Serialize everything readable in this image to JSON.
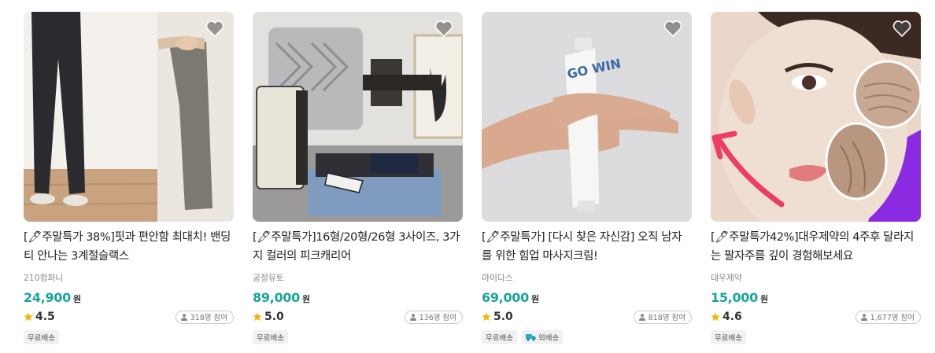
{
  "products": [
    {
      "title": "[🖊주말특가 38%]핏과 편안함 최대치! 밴딩 티 안나는 3계절슬랙스",
      "seller": "210컴퍼니",
      "price": "24,900",
      "currency": "원",
      "rating": "4.5",
      "participants": "318명 참여",
      "tags": [
        "무료배송"
      ],
      "image_icon": "slacks-photo"
    },
    {
      "title": "[🖊주말특가]16형/20형/26형 3사이즈, 3가지 컬러의 피크캐리어",
      "seller": "공정뮤토",
      "price": "89,000",
      "currency": "원",
      "rating": "5.0",
      "participants": "136명 참여",
      "tags": [
        "무료배송"
      ],
      "image_icon": "carrier-photo"
    },
    {
      "title": "[🖊주말특가] [다시 찾은 자신감] 오직 남자를 위한 힘업 마사지크림!",
      "seller": "마이다스",
      "price": "69,000",
      "currency": "원",
      "rating": "5.0",
      "participants": "818명 참여",
      "tags": [
        "무료배송",
        "외배송"
      ],
      "image_icon": "cream-tube-photo"
    },
    {
      "title": "[🖊주말특가42%]대우제약의 4주후 달라지는 팔자주름 깊이 경험해보세요",
      "seller": "대우제약",
      "price": "15,000",
      "currency": "원",
      "rating": "4.6",
      "participants": "1,677명 참여",
      "tags": [
        "무료배송"
      ],
      "image_icon": "face-wrinkle-photo"
    }
  ],
  "colors": {
    "price": "#1aa59a",
    "star": "#f5b400",
    "truck": "#2ea8c9"
  },
  "icons": {
    "wishlist": "heart-icon",
    "rating": "star-icon",
    "participants": "person-icon",
    "delivery": "truck-icon"
  }
}
